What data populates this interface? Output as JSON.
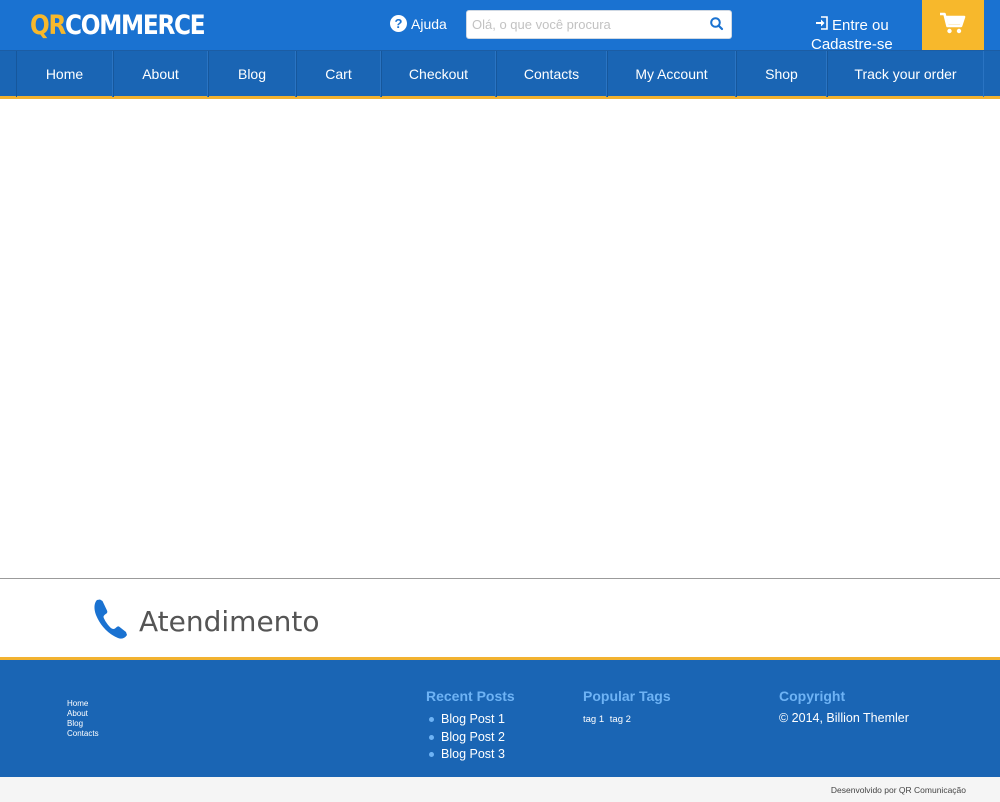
{
  "header": {
    "logo_qr": "QR",
    "logo_commerce": "COMMERCE",
    "help_label": "Ajuda",
    "search_placeholder": "Olá, o que você procura",
    "login_line1": "Entre ou",
    "login_line2": "Cadastre-se",
    "icons": {
      "help": "question-circle-icon",
      "search": "search-icon",
      "login": "sign-in-icon",
      "cart": "shopping-cart-icon"
    }
  },
  "nav": {
    "items": [
      "Home",
      "About",
      "Blog",
      "Cart",
      "Checkout",
      "Contacts",
      "My Account",
      "Shop",
      "Track your order"
    ]
  },
  "support": {
    "label": "Atendimento",
    "icon": "phone-icon"
  },
  "footer": {
    "links": [
      "Home",
      "About",
      "Blog",
      "Contacts"
    ],
    "recent_posts_title": "Recent Posts",
    "recent_posts": [
      "Blog Post 1",
      "Blog Post 2",
      "Blog Post 3"
    ],
    "popular_tags_title": "Popular Tags",
    "tags": [
      "tag 1",
      "tag 2"
    ],
    "copyright_title": "Copyright",
    "copyright_text": "© 2014, Billion Themler"
  },
  "bottom": {
    "developer_credit": "Desenvolvido por QR Comunicação"
  },
  "colors": {
    "header_blue": "#1a72d1",
    "nav_blue": "#1a65b4",
    "accent_yellow": "#f7b82c",
    "footer_title_blue": "#6eb3f5"
  }
}
